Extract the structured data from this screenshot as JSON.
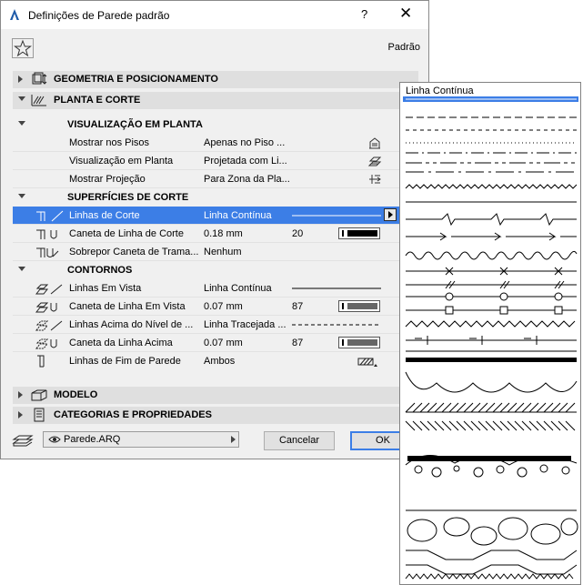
{
  "window": {
    "title": "Definições de Parede padrão",
    "help": "?",
    "close": "✕"
  },
  "toolbar": {
    "favorites_icon": "star-icon",
    "preset_label": "Padrão"
  },
  "sections": {
    "geometry": "GEOMETRIA E POSICIONAMENTO",
    "plan": "PLANTA E CORTE",
    "model": "MODELO",
    "categories": "CATEGORIAS E PROPRIEDADES"
  },
  "plan_view": {
    "header": "VISUALIZAÇÃO EM PLANTA",
    "rows": [
      {
        "name": "Mostrar nos Pisos",
        "value": "Apenas no Piso ..."
      },
      {
        "name": "Visualização em Planta",
        "value": "Projetada com Li..."
      },
      {
        "name": "Mostrar Projeção",
        "value": "Para Zona da Pla..."
      }
    ]
  },
  "cut_surfaces": {
    "header": "SUPERFÍCIES DE CORTE",
    "rows": [
      {
        "name": "Linhas de Corte",
        "value": "Linha Contínua"
      },
      {
        "name": "Caneta de Linha de Corte",
        "value": "0.18 mm",
        "pen": "20",
        "pen_color": "#000000"
      },
      {
        "name": "Sobrepor Caneta de Trama...",
        "value": "Nenhum"
      }
    ]
  },
  "outlines": {
    "header": "CONTORNOS",
    "rows": [
      {
        "name": "Linhas Em Vista",
        "value": "Linha Contínua"
      },
      {
        "name": "Caneta de Linha Em Vista",
        "value": "0.07 mm",
        "pen": "87",
        "pen_color": "#666666"
      },
      {
        "name": "Linhas Acima do Nível de ...",
        "value": "Linha Tracejada ..."
      },
      {
        "name": "Caneta da Linha Acima",
        "value": "0.07 mm",
        "pen": "87",
        "pen_color": "#666666"
      },
      {
        "name": "Linhas de Fim de Parede",
        "value": "Ambos"
      }
    ]
  },
  "footer": {
    "layer": "Parede.ARQ",
    "cancel": "Cancelar",
    "ok": "OK"
  },
  "line_popup": {
    "selected": "Linha Contínua"
  },
  "colors": {
    "selection": "#3c7ee6",
    "section_bg": "#dfdfdf",
    "dialog_bg": "#f0f0f0"
  }
}
